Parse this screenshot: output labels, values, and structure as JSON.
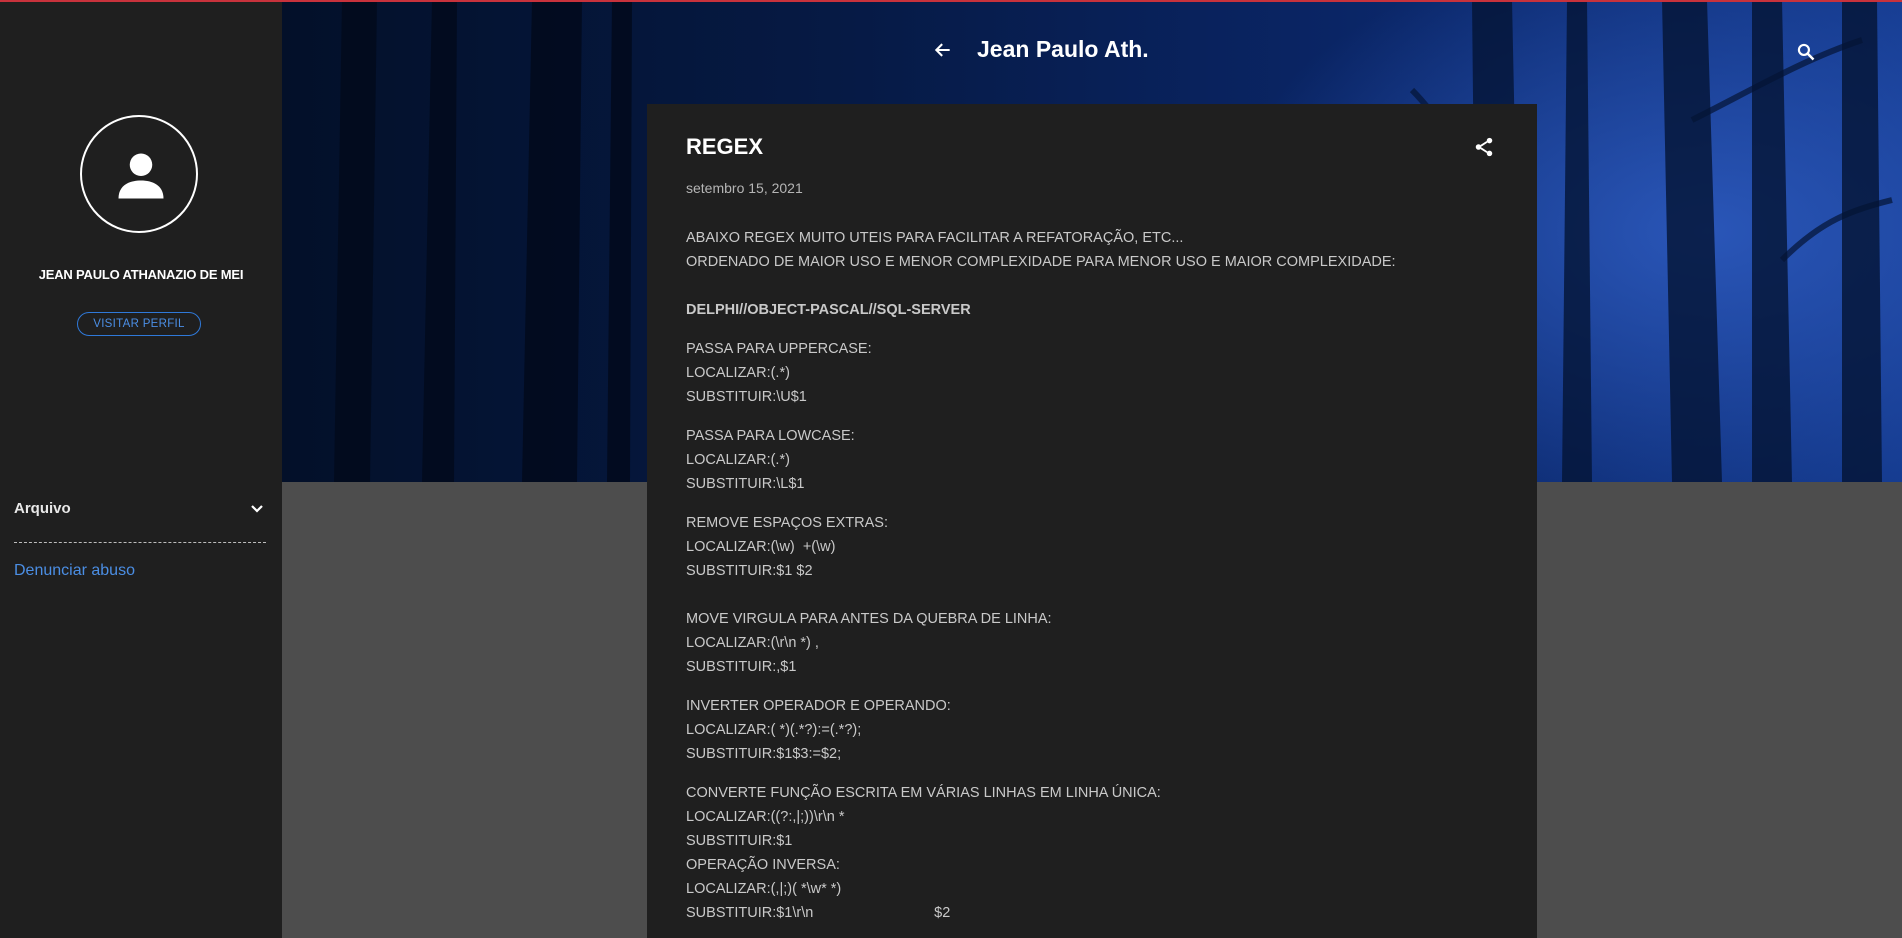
{
  "header": {
    "blog_title": "Jean Paulo Ath."
  },
  "sidebar": {
    "profile_name": "JEAN PAULO ATHANAZIO DE MEI",
    "visit_profile_label": "VISITAR PERFIL",
    "archive_label": "Arquivo",
    "report_abuse_label": "Denunciar abuso"
  },
  "post": {
    "title": "REGEX",
    "date": "setembro 15, 2021",
    "intro_1": "ABAIXO REGEX MUITO UTEIS PARA FACILITAR A REFATORAÇÃO, ETC...",
    "intro_2": "ORDENADO DE MAIOR USO E MENOR COMPLEXIDADE PARA MENOR USO E MAIOR COMPLEXIDADE:",
    "section_heading": "DELPHI//OBJECT-PASCAL//SQL-SERVER",
    "blocks": [
      {
        "title": "PASSA PARA UPPERCASE:",
        "find": "LOCALIZAR:(.*)",
        "replace": "SUBSTITUIR:\\U$1"
      },
      {
        "title": "PASSA PARA LOWCASE:",
        "find": "LOCALIZAR:(.*)",
        "replace": "SUBSTITUIR:\\L$1"
      },
      {
        "title": "REMOVE ESPAÇOS EXTRAS:",
        "find": "LOCALIZAR:(\\w)  +(\\w)",
        "replace": "SUBSTITUIR:$1 $2"
      },
      {
        "title": "MOVE VIRGULA PARA ANTES DA QUEBRA DE LINHA:",
        "find": "LOCALIZAR:(\\r\\n *) ,",
        "replace": "SUBSTITUIR:,$1"
      },
      {
        "title": "INVERTER OPERADOR E OPERANDO:",
        "find": "LOCALIZAR:( *)(.*?):=(.*?);",
        "replace": "SUBSTITUIR:$1$3:=$2;"
      },
      {
        "title": "CONVERTE FUNÇÃO ESCRITA EM VÁRIAS LINHAS EM LINHA ÚNICA:",
        "find": "LOCALIZAR:((?:,|;))\\r\\n *",
        "replace": "SUBSTITUIR:$1"
      }
    ],
    "inverse_title": "OPERAÇÃO INVERSA:",
    "inverse_find": "LOCALIZAR:(,|;)( *\\w* *)",
    "inverse_replace": "SUBSTITUIR:$1\\r\\n                              $2"
  }
}
